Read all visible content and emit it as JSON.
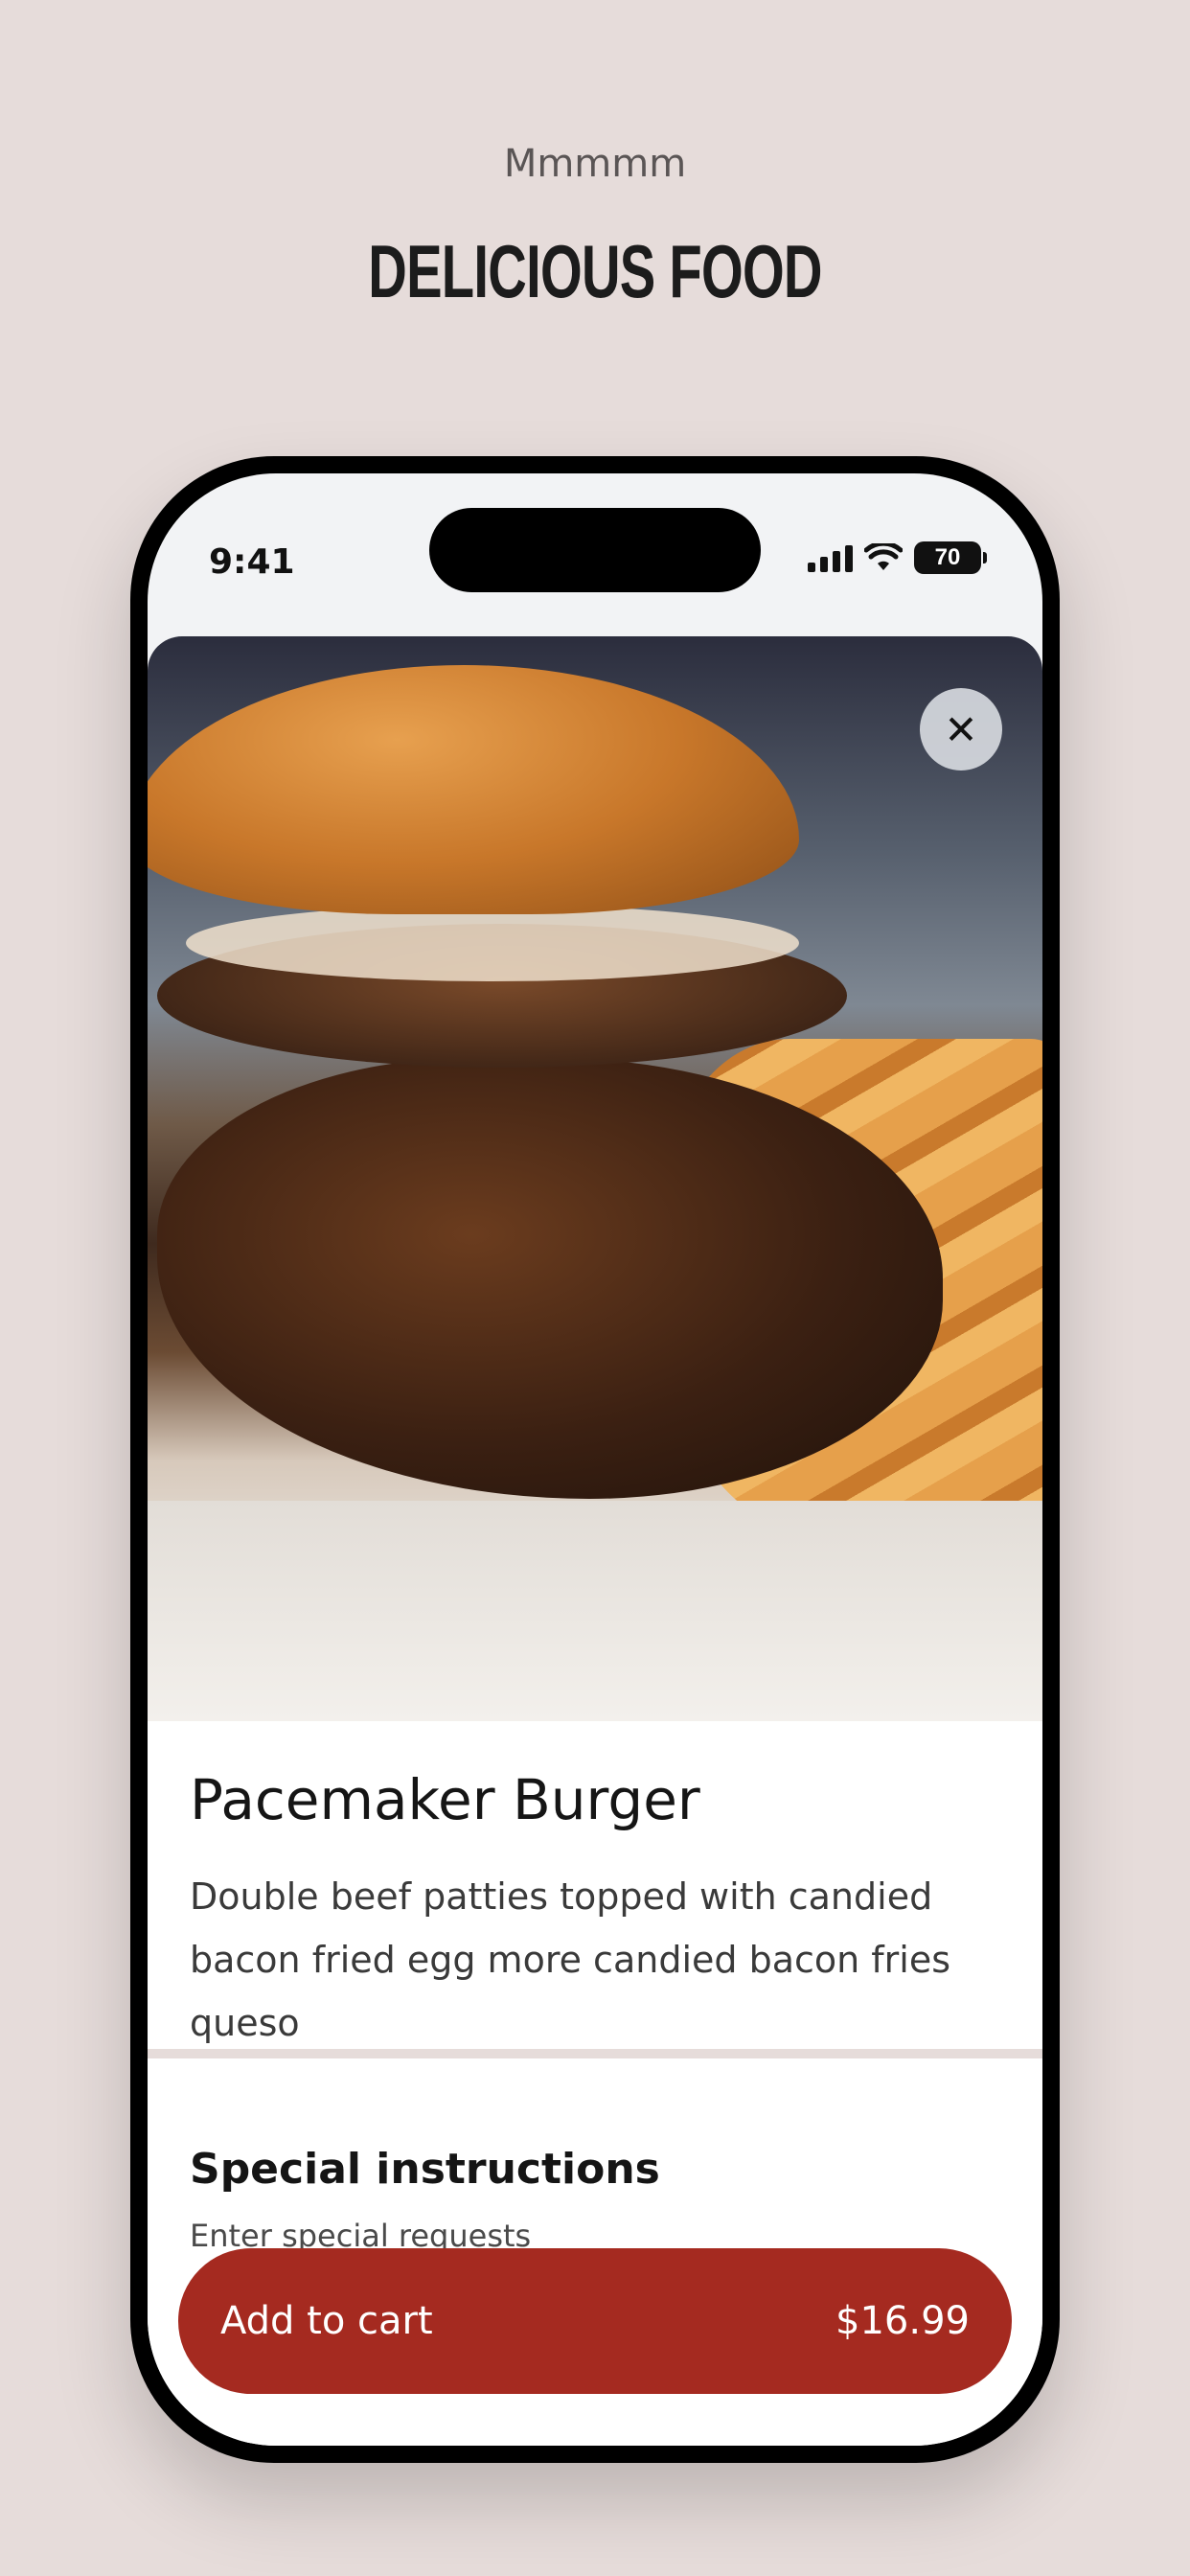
{
  "hero": {
    "eyebrow": "Mmmmm",
    "headline": "DELICIOUS FOOD"
  },
  "status_bar": {
    "time": "9:41",
    "battery": "70"
  },
  "item": {
    "image_alt": "burger-photo",
    "title": "Pacemaker Burger",
    "description": "Double beef patties topped with candied bacon fried egg more candied bacon fries queso"
  },
  "special_instructions": {
    "title": "Special instructions",
    "placeholder": "Enter special requests"
  },
  "cart": {
    "label": "Add to cart",
    "price": "$16.99"
  },
  "colors": {
    "background": "#e6dcda",
    "accent": "#a52a20"
  },
  "icons": {
    "close": "close-icon"
  }
}
